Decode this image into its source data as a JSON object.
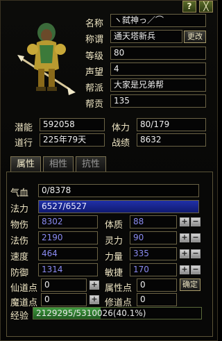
{
  "window": {
    "help_label": "?",
    "close_label": "╳"
  },
  "profile": {
    "name_label": "名称",
    "name_value": "ヽ弑神っ／⌒",
    "title_label": "称谓",
    "title_value": "通天塔新兵",
    "change_button": "更改",
    "level_label": "等级",
    "level_value": "80",
    "prestige_label": "声望",
    "prestige_value": "4",
    "guild_label": "帮派",
    "guild_value": "大家是兄弟帮",
    "contribution_label": "帮贡",
    "contribution_value": "135"
  },
  "stats_top": {
    "potential_label": "潜能",
    "potential_value": "592058",
    "stamina_label": "体力",
    "stamina_value": "80/179",
    "cultivation_label": "道行",
    "cultivation_value": "225年79天",
    "merit_label": "战绩",
    "merit_value": "8632"
  },
  "tabs": [
    {
      "label": "属性",
      "active": true
    },
    {
      "label": "相性",
      "active": false
    },
    {
      "label": "抗性",
      "active": false
    }
  ],
  "attributes": {
    "hp_label": "气血",
    "hp_value": "0/8378",
    "mana_label": "法力",
    "mana_value": "6527/6527",
    "phys_atk_label": "物伤",
    "phys_atk_value": "8302",
    "constitution_label": "体质",
    "constitution_value": "88",
    "magic_atk_label": "法伤",
    "magic_atk_value": "2190",
    "spirit_label": "灵力",
    "spirit_value": "90",
    "speed_label": "速度",
    "speed_value": "464",
    "strength_label": "力量",
    "strength_value": "335",
    "defense_label": "防御",
    "defense_value": "1314",
    "agility_label": "敏捷",
    "agility_value": "170",
    "immortal_points_label": "仙道点",
    "immortal_points_value": "0",
    "attr_points_label": "属性点",
    "attr_points_value": "0",
    "confirm_button": "确定",
    "demon_points_label": "魔道点",
    "demon_points_value": "0",
    "cultivation_points_label": "修道点",
    "cultivation_points_value": "0",
    "exp_label": "经验",
    "exp_text": "2129295/5310026(40.1%)",
    "exp_fraction": 0.401
  },
  "icons": {
    "plus": "+",
    "minus": "−"
  },
  "colors": {
    "mana_bar": "#1a2898",
    "exp_fill": "#2f7a2f",
    "blue_text": "#8a8af0"
  }
}
